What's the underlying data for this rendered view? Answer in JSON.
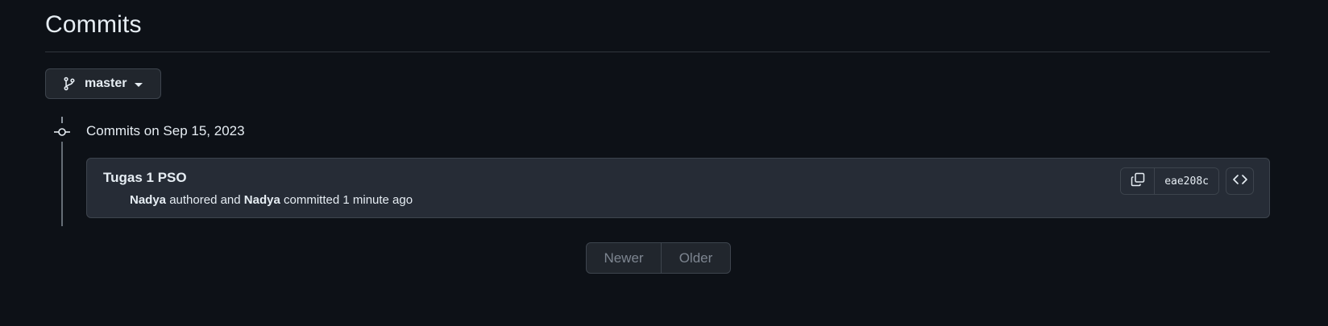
{
  "page": {
    "title": "Commits"
  },
  "branch": {
    "name": "master",
    "icon": "git-branch-icon"
  },
  "timeline": {
    "day_heading": "Commits on Sep 15, 2023",
    "icon": "git-commit-icon"
  },
  "commits": [
    {
      "title": "Tugas 1 PSO",
      "author": "Nadya",
      "authored_text": "authored and",
      "committer": "Nadya",
      "committed_text": "committed",
      "time_ago": "1 minute ago",
      "sha": "eae208c",
      "copy_icon": "copy-icon",
      "browse_icon": "code-icon"
    }
  ],
  "pagination": {
    "newer_label": "Newer",
    "older_label": "Older"
  },
  "colors": {
    "background": "#0d1117",
    "card": "#262c36",
    "border": "#3d444d",
    "text": "#e6edf3",
    "muted": "#7d8590"
  }
}
